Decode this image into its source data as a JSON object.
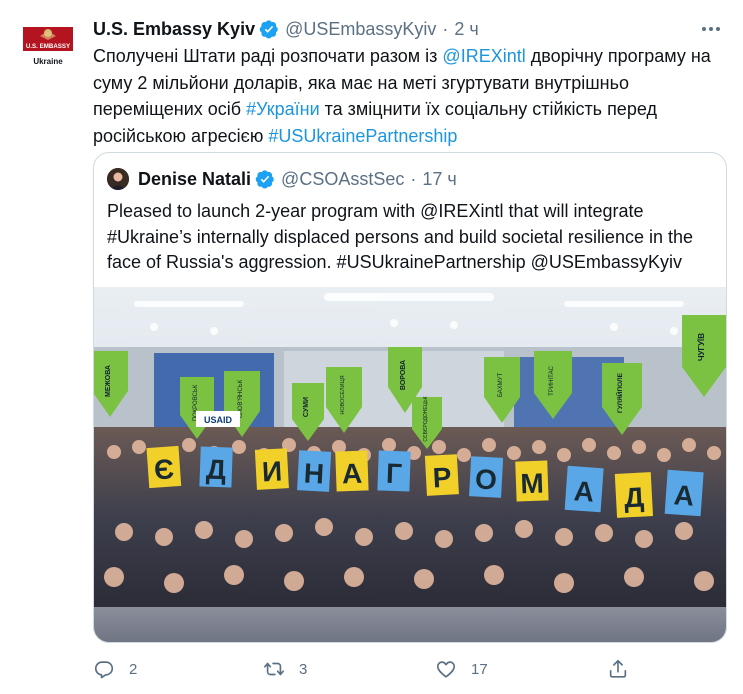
{
  "tweet": {
    "author_name": "U.S. Embassy Kyiv",
    "author_handle": "@USEmbassyKyiv",
    "separator": "·",
    "time": "2 ч",
    "avatar": {
      "top_text": "U.S. EMBASSY",
      "bottom_text": "Ukraine"
    },
    "text": {
      "part1": "Сполучені Штати раді розпочати разом із ",
      "mention": "@IREXintl",
      "part2": " дворічну програму на суму 2 мільйони доларів, яка має на меті згуртувати внутрішньо переміщених осіб ",
      "hashtag1": "#України",
      "part3": " та зміцнити їх соціальну стійкість перед російською агресією ",
      "hashtag2": "#USUkrainePartnership"
    }
  },
  "quoted": {
    "author_name": "Denise Natali",
    "author_handle": "@CSOAsstSec",
    "separator": "·",
    "time": "17 ч",
    "text": "Pleased to launch 2-year program with @IREXintl that will integrate #Ukraine’s internally displaced persons and build societal resilience in the face of Russia's aggression. #USUkrainePartnership @USEmbassyKyiv",
    "photo": {
      "banner_letters": [
        "Є",
        "Д",
        "И",
        "Н",
        "А",
        "Г",
        "Р",
        "О",
        "М",
        "А",
        "Д",
        "А"
      ],
      "pin_labels": [
        "МЕЖОВА",
        "ПОКРОВСЬК",
        "СЛОВ'ЯНСЬК",
        "СУМИ",
        "НОВОСЕЛИЦЯ",
        "ВОРОВА",
        "БАХМУТ",
        "ТРИНІТАС",
        "СЄВЄРОДОНЕЦЬК",
        "ГУЛЯЙПОЛЕ",
        "ЧУГУЇВ"
      ],
      "logo": "USAID"
    }
  },
  "actions": {
    "replies": "2",
    "retweets": "3",
    "likes": "17"
  },
  "colors": {
    "link": "#1b95e0",
    "muted": "#5b7083",
    "verified": "#1da1f2",
    "border": "#cfd9de"
  }
}
